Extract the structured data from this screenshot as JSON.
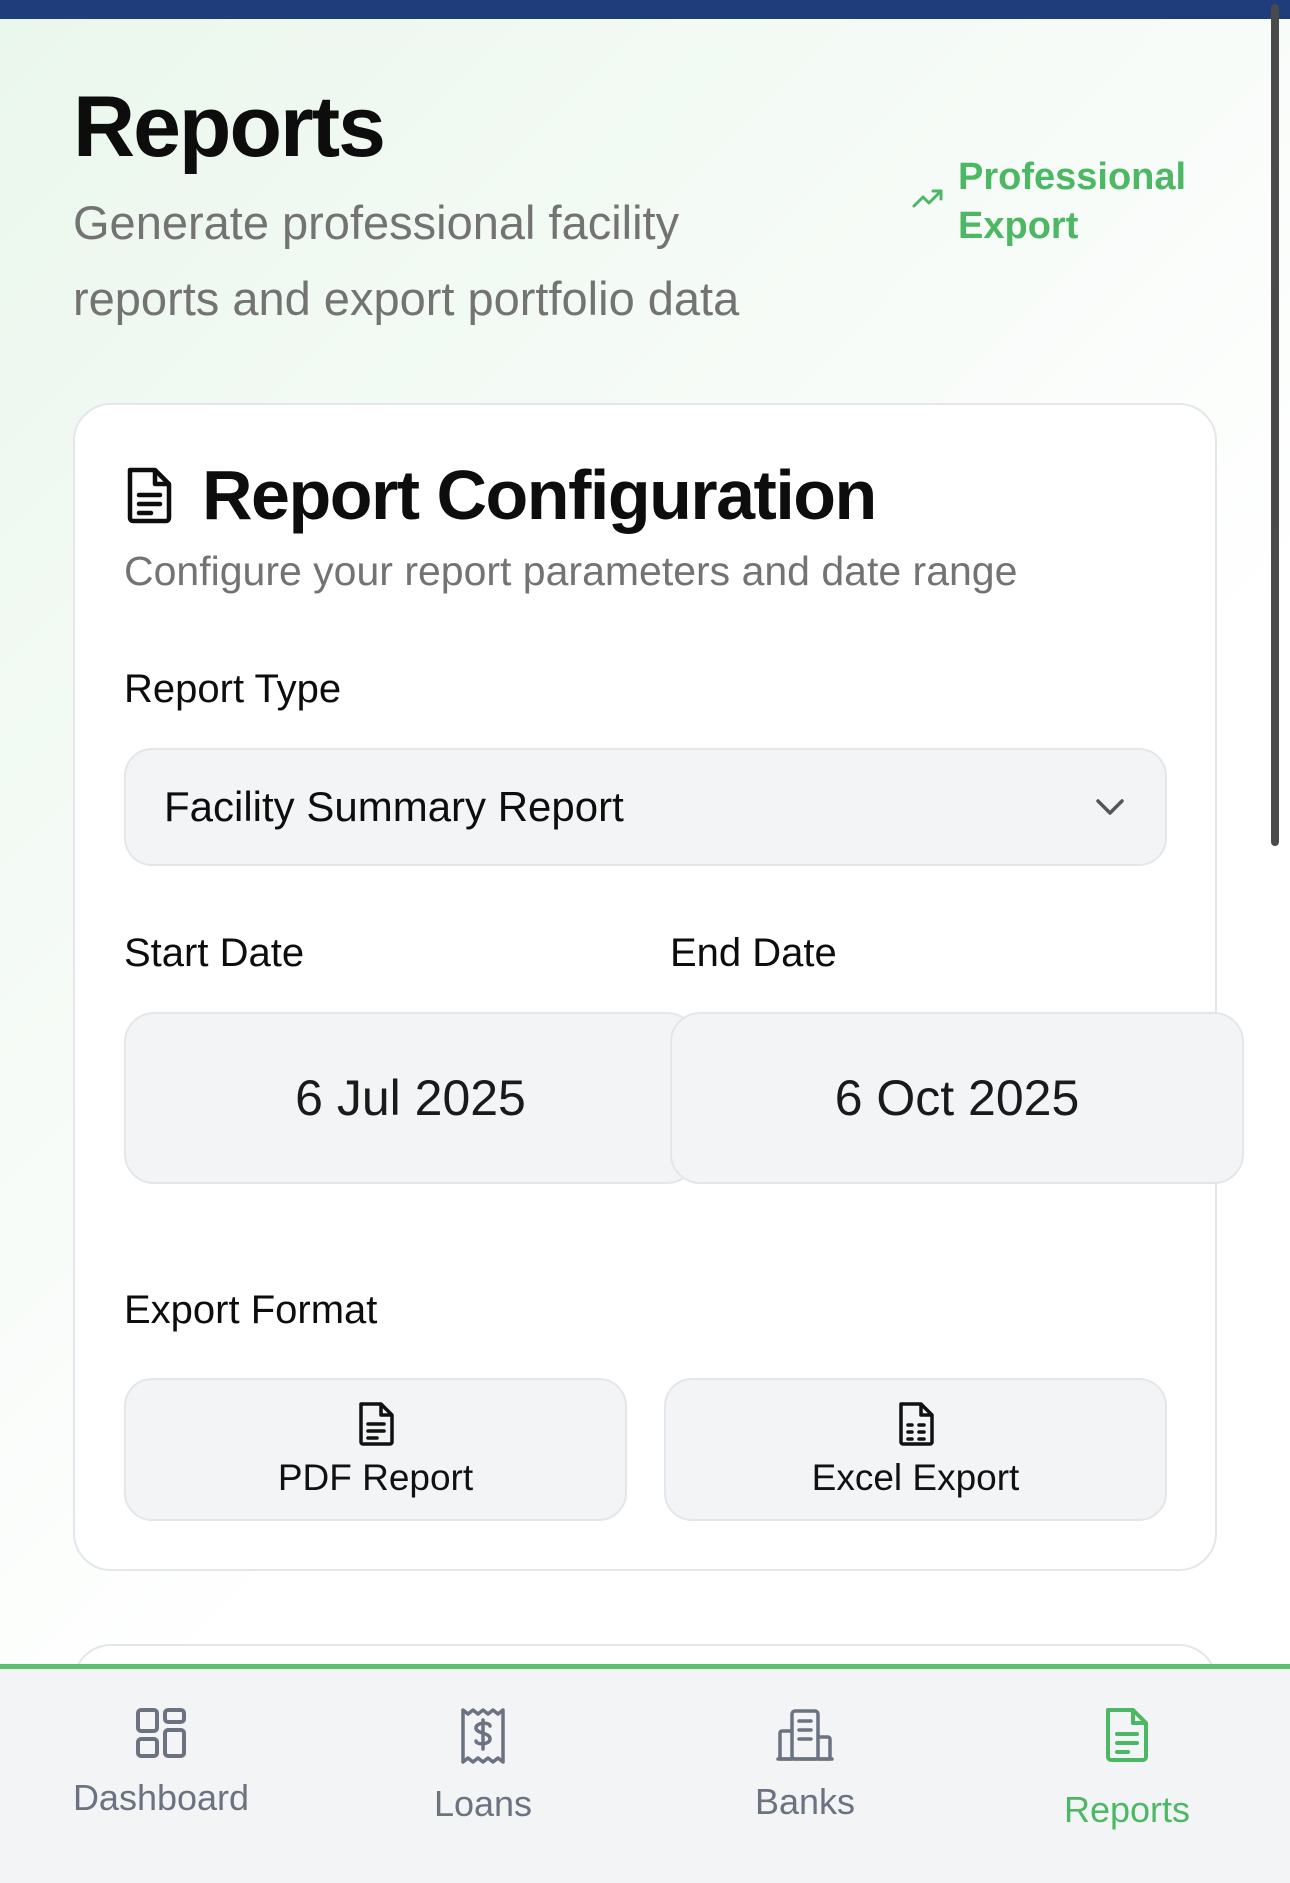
{
  "header": {
    "title": "Reports",
    "subtitle": "Generate professional facility reports and export portfolio data",
    "badge": "Professional Export"
  },
  "config": {
    "title": "Report Configuration",
    "subtitle": "Configure your report parameters and date range",
    "report_type_label": "Report Type",
    "report_type_value": "Facility Summary Report",
    "start_date_label": "Start Date",
    "start_date_value": "6 Jul 2025",
    "end_date_label": "End Date",
    "end_date_value": "6 Oct 2025",
    "export_format_label": "Export Format",
    "formats": [
      {
        "label": "PDF Report",
        "icon": "file-text-icon"
      },
      {
        "label": "Excel Export",
        "icon": "file-spreadsheet-icon"
      }
    ]
  },
  "nav": {
    "items": [
      {
        "label": "Dashboard",
        "icon": "grid-icon",
        "active": false
      },
      {
        "label": "Loans",
        "icon": "receipt-dollar-icon",
        "active": false
      },
      {
        "label": "Banks",
        "icon": "building-icon",
        "active": false
      },
      {
        "label": "Reports",
        "icon": "file-text-icon",
        "active": true
      }
    ]
  },
  "colors": {
    "accent": "#4cb864",
    "top_bar": "#1e3d7a",
    "muted_text": "#737373",
    "field_bg": "#f3f4f6"
  }
}
